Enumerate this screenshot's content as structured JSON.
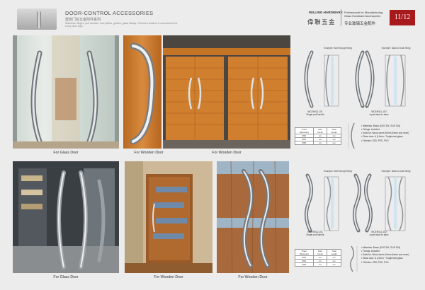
{
  "header": {
    "title": "DOOR-CONTROL ACCESSORIES",
    "title_cn": "建筑门控五金附件系列",
    "intro": "Stainless hinges, pull handles, kick plates, guides, glass fittings. Premium finishes & accessories for every door type.",
    "brand_en": "WILLING HARDWARE",
    "brand_cn": "偉聯五金",
    "tagline": "Professional for Manufacturing Glass Hardware Accessories",
    "tagline_cn": "专业玻璃五金配件",
    "page_number": "11/12"
  },
  "captions": {
    "glass1": "For Glass Door",
    "wood1": "For Wooden Door",
    "wood2": "For Wooden Door",
    "glass2": "For Glass Door",
    "wood3": "For Wooden Door",
    "wood4": "For Wooden Door"
  },
  "product_top": {
    "install_left": "Example: Bolt through fixing",
    "install_right": "Example: Back to back fixing",
    "code_left": "WCEH011-101",
    "code_left_sub": "Single pull handle",
    "code_right": "WCEH011-102",
    "code_right_sub": "A pair back to back",
    "table_header": [
      "Order (Diameter)",
      "Hole Center",
      "Total Length"
    ],
    "table_rows": [
      [
        "Ø25",
        "xxx",
        "xxx"
      ],
      [
        "Ø32",
        "xxx",
        "xxx"
      ],
      [
        "Ø38",
        "xxx",
        "xxx"
      ]
    ],
    "features": [
      "Materials: Brass (SUS 304, SUS 316)",
      "Fixings: included",
      "Suits for: Wood doors 40mm (Nmm and more)",
      "Glass door: A (10mm~ Toughened glass",
      "Finishes: SSS, PSS, PVD"
    ]
  },
  "product_bottom": {
    "install_left": "Example: Bolt through fixing",
    "install_right": "Example: Back to back fixing",
    "code_left": "WCEH012-101",
    "code_left_sub": "Single pull handle",
    "code_right": "WCEH012-102",
    "code_right_sub": "A pair back to back",
    "table_header": [
      "Order (Diameter)",
      "Hole Center",
      "Total Length"
    ],
    "table_rows": [
      [
        "Ø25",
        "xxx",
        "xxx"
      ],
      [
        "Ø32",
        "xxx",
        "xxx"
      ],
      [
        "Ø38",
        "xxx",
        "xxx"
      ]
    ],
    "features": [
      "Materials: Brass (SUS 304, SUS 316)",
      "Fixings: included",
      "Suits for: Wood doors 40mm (Nmm and more)",
      "Glass door: A (10mm~ Toughened glass",
      "Finishes: SSS, PSS, PVD"
    ]
  },
  "colors": {
    "accent": "#a8191b",
    "wood": "#c97a34",
    "steel": "#bfc3c7"
  }
}
